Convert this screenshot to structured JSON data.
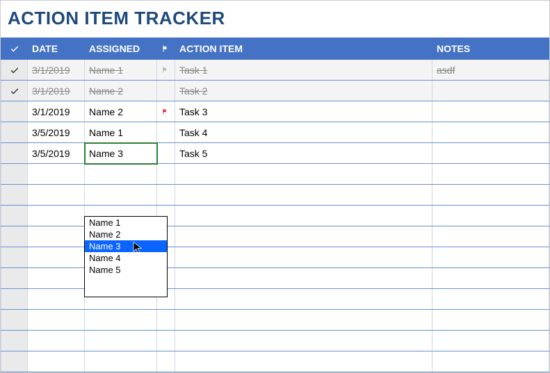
{
  "title": "ACTION ITEM TRACKER",
  "headers": {
    "date": "DATE",
    "assigned": "ASSIGNED",
    "action_item": "ACTION ITEM",
    "notes": "NOTES"
  },
  "rows": [
    {
      "done": true,
      "date": "3/1/2019",
      "assigned": "Name 1",
      "flag": "grey",
      "item": "Task 1",
      "notes": "asdf"
    },
    {
      "done": true,
      "date": "3/1/2019",
      "assigned": "Name 2",
      "flag": "",
      "item": "Task 2",
      "notes": ""
    },
    {
      "done": false,
      "date": "3/1/2019",
      "assigned": "Name 2",
      "flag": "red",
      "item": "Task 3",
      "notes": ""
    },
    {
      "done": false,
      "date": "3/5/2019",
      "assigned": "Name 1",
      "flag": "",
      "item": "Task 4",
      "notes": ""
    },
    {
      "done": false,
      "date": "3/5/2019",
      "assigned": "Name 3",
      "flag": "",
      "item": "Task 5",
      "notes": "",
      "active": true
    }
  ],
  "empty_row_count": 10,
  "dropdown": {
    "options": [
      "Name 1",
      "Name 2",
      "Name 3",
      "Name 4",
      "Name 5"
    ],
    "selected_index": 2
  }
}
